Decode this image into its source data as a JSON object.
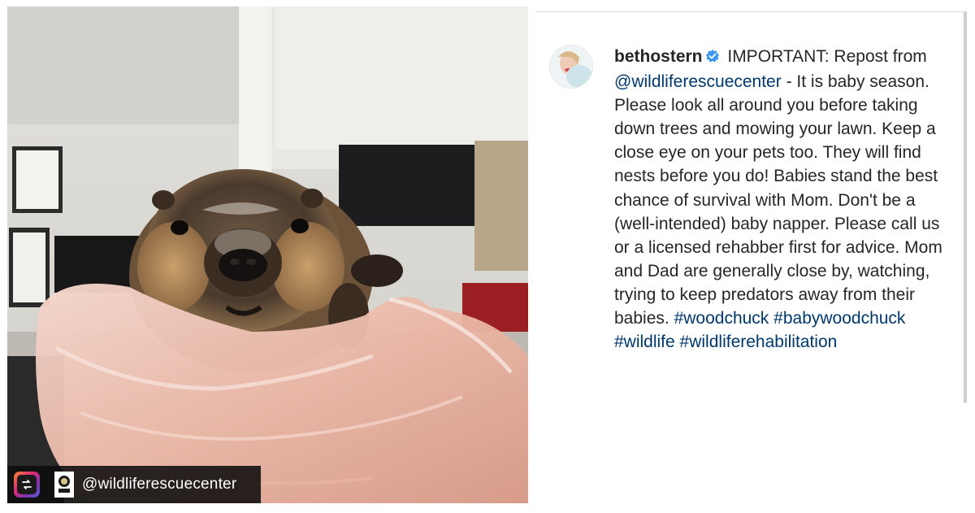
{
  "photo": {
    "subject": "baby woodchuck held in gloved hands",
    "repost_bar": {
      "handle": "@wildliferescuecenter"
    }
  },
  "post": {
    "username": "bethostern",
    "verified": true,
    "caption": {
      "intro": "IMPORTANT: Repost from",
      "mention": "@wildliferescuecenter",
      "body": "- It is baby season. Please look all around you before taking down trees and mowing your lawn. Keep a close eye on your pets too. They will find nests before you do! Babies stand the best chance of survival with Mom. Don't be a (well-intended) baby napper. Please call us or a licensed rehabber first for advice. Mom and Dad are generally close by, watching, trying to keep predators away from their babies.",
      "hashtags": [
        "#woodchuck",
        "#babywoodchuck",
        "#wildlife",
        "#wildliferehabilitation"
      ]
    }
  },
  "colors": {
    "link": "#00376b",
    "verified_badge": "#3897f0",
    "text": "#262626"
  },
  "icons": [
    "repost-app-icon",
    "org-logo-icon",
    "verified-badge-icon",
    "avatar"
  ]
}
